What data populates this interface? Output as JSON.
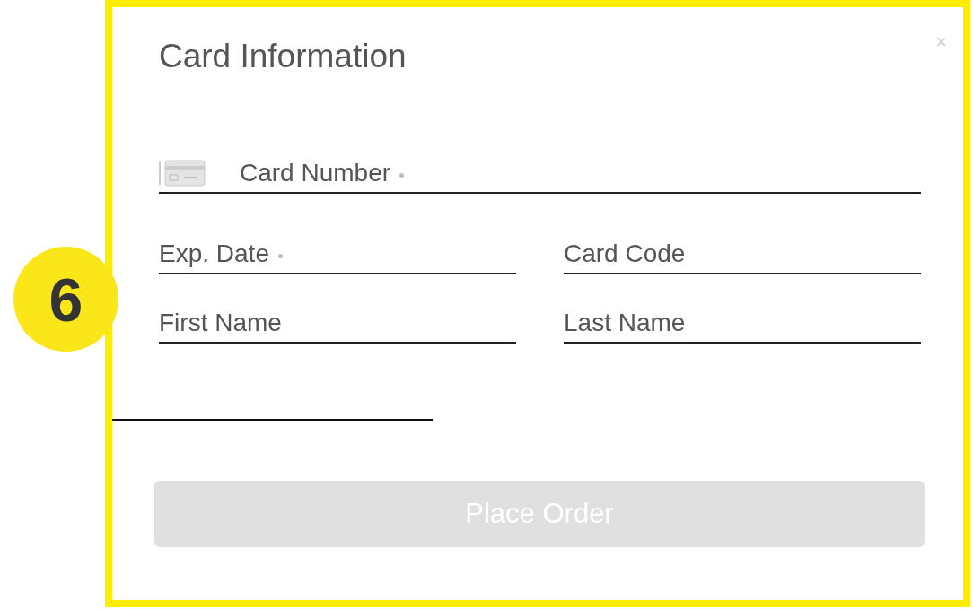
{
  "callout": {
    "label": "6"
  },
  "dialog": {
    "title": "Card Information",
    "close": "×",
    "card_number": {
      "label": "Card Number",
      "required": true
    },
    "rows": [
      [
        {
          "label": "Exp. Date",
          "required": true
        },
        {
          "label": "Card Code",
          "required": false
        }
      ],
      [
        {
          "label": "First Name",
          "required": false
        },
        {
          "label": "Last Name",
          "required": false
        }
      ]
    ],
    "submit": {
      "label": "Place Order",
      "disabled": true
    }
  }
}
